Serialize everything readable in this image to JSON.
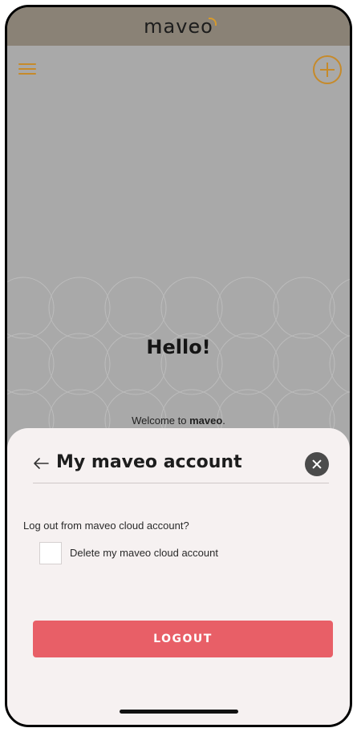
{
  "app": {
    "logo_text": "maveo"
  },
  "icons": {
    "menu": "menu-icon",
    "add": "add-circle-icon",
    "back": "arrow-left-icon",
    "close": "close-icon"
  },
  "colors": {
    "accent": "#c68a2a",
    "logout": "#e85f67",
    "topbar": "#8a8276"
  },
  "main": {
    "greeting": "Hello!",
    "welcome_prefix": "Welcome to ",
    "welcome_brand": "maveo",
    "welcome_suffix": "."
  },
  "sheet": {
    "title": "My maveo account",
    "question": "Log out from maveo cloud account?",
    "delete_label": "Delete my maveo cloud account",
    "delete_checked": false,
    "logout_label": "LOGOUT"
  }
}
